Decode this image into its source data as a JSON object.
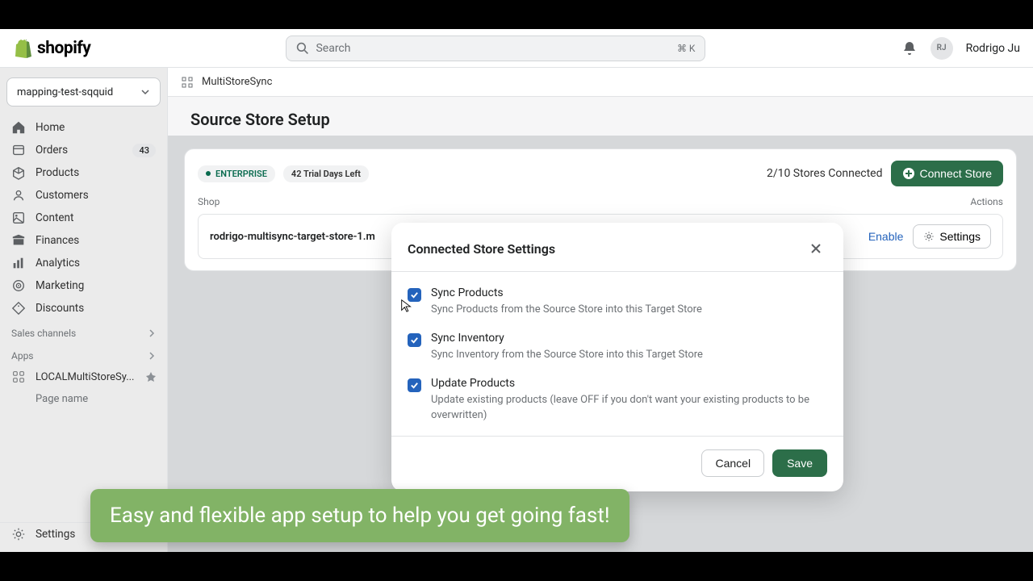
{
  "brand": "shopify",
  "search": {
    "placeholder": "Search",
    "kbd": "⌘ K"
  },
  "user": {
    "initials": "RJ",
    "name": "Rodrigo Ju"
  },
  "storeSwitcher": "mapping-test-sqquid",
  "nav": {
    "home": "Home",
    "orders": "Orders",
    "ordersBadge": "43",
    "products": "Products",
    "customers": "Customers",
    "content": "Content",
    "finances": "Finances",
    "analytics": "Analytics",
    "marketing": "Marketing",
    "discounts": "Discounts",
    "salesChannels": "Sales channels",
    "apps": "Apps",
    "appName": "LOCALMultiStoreSy...",
    "pageName": "Page name",
    "settings": "Settings"
  },
  "crumb": "MultiStoreSync",
  "pageTitle": "Source Store Setup",
  "badges": {
    "tier": "ENTERPRISE",
    "trial": "42 Trial Days Left"
  },
  "storesConnected": "2/10 Stores Connected",
  "connectStore": "Connect Store",
  "table": {
    "colShop": "Shop",
    "colActions": "Actions",
    "row1Shop": "rodrigo-multisync-target-store-1.m",
    "enable": "Enable",
    "settings": "Settings"
  },
  "modal": {
    "title": "Connected Store Settings",
    "opt1": {
      "title": "Sync Products",
      "desc": "Sync Products from the Source Store into this Target Store"
    },
    "opt2": {
      "title": "Sync Inventory",
      "desc": "Sync Inventory from the Source Store into this Target Store"
    },
    "opt3": {
      "title": "Update Products",
      "desc": "Update existing products (leave OFF if you don't want your existing products to be overwritten)"
    },
    "cancel": "Cancel",
    "save": "Save"
  },
  "toast": "Easy and flexible app setup to help you get going fast!"
}
